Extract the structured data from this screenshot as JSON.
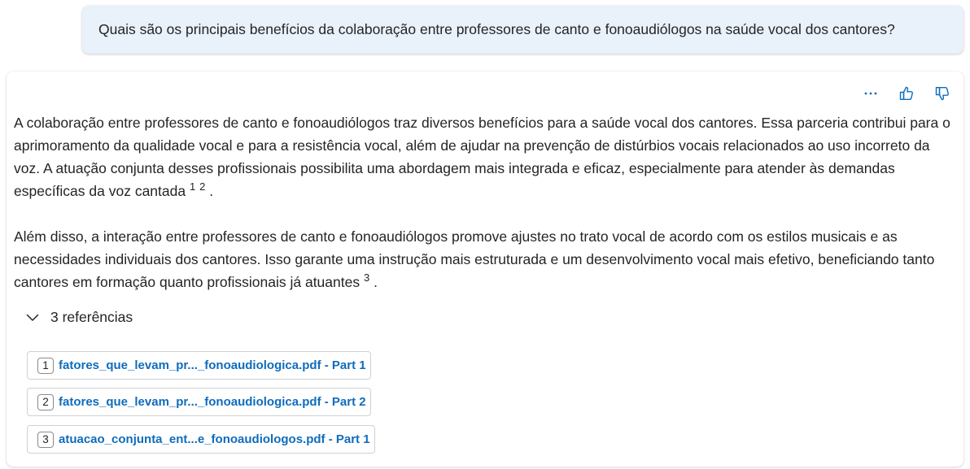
{
  "user_message": "Quais são os principais benefícios da colaboração entre professores de canto e fonoaudiólogos na saúde vocal dos cantores?",
  "actions": {
    "more_label": "...",
    "like_icon": "thumbs-up-icon",
    "dislike_icon": "thumbs-down-icon"
  },
  "answer": {
    "p1_text": "A colaboração entre professores de canto e fonoaudiólogos traz diversos benefícios para a saúde vocal dos cantores. Essa parceria contribui para o aprimoramento da qualidade vocal e para a resistência vocal, além de ajudar na prevenção de distúrbios vocais relacionados ao uso incorreto da voz. A atuação conjunta desses profissionais possibilita uma abordagem mais integrada e eficaz, especialmente para atender às demandas específicas da voz cantada",
    "p1_cite_1": "1",
    "p1_cite_2": "2",
    "p1_end": ".",
    "p2_text": "Além disso, a interação entre professores de canto e fonoaudiólogos promove ajustes no trato vocal de acordo com os estilos musicais e as necessidades individuais dos cantores. Isso garante uma instrução mais estruturada e um desenvolvimento vocal mais efetivo, beneficiando tanto cantores em formação quanto profissionais já atuantes",
    "p2_cite_1": "3",
    "p2_end": "."
  },
  "references": {
    "toggle_label": "3 referências",
    "items": [
      {
        "num": "1",
        "label": "fatores_que_levam_pr..._fonoaudiologica.pdf - Part 1"
      },
      {
        "num": "2",
        "label": "fatores_que_levam_pr..._fonoaudiologica.pdf - Part 2"
      },
      {
        "num": "3",
        "label": "atuacao_conjunta_ent...e_fonoaudiologos.pdf - Part 1"
      }
    ]
  },
  "colors": {
    "user_bubble_bg": "#e9f1fb",
    "accent": "#0f6cbd",
    "text": "#242424"
  }
}
